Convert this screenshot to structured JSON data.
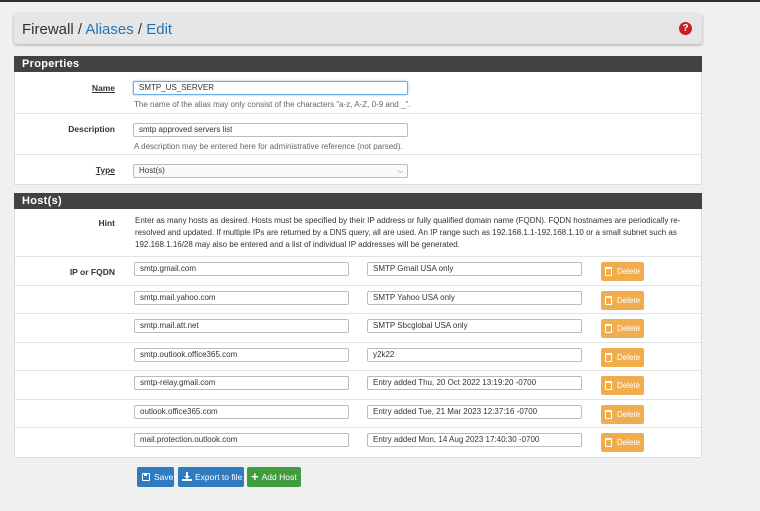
{
  "breadcrumb": {
    "root": "Firewall",
    "sep": "/",
    "aliases": "Aliases",
    "current": "Edit",
    "help": "?"
  },
  "properties": {
    "heading": "Properties",
    "name_label": "Name",
    "name_value": "SMTP_US_SERVER",
    "name_help": "The name of the alias may only consist of the characters \"a-z, A-Z, 0-9 and _\".",
    "description_label": "Description",
    "description_value": "smtp approved servers list",
    "description_help": "A description may be entered here for administrative reference (not parsed).",
    "type_label": "Type",
    "type_value": "Host(s)"
  },
  "hosts": {
    "heading": "Host(s)",
    "hint_label": "Hint",
    "hint_text": "Enter as many hosts as desired. Hosts must be specified by their IP address or fully qualified domain name (FQDN). FQDN hostnames are periodically re-resolved and updated. If multiple IPs are returned by a DNS query, all are used. An IP range such as 192.168.1.1-192.168.1.10 or a small subnet such as 192.168.1.16/28 may also be entered and a list of individual IP addresses will be generated.",
    "ip_label": "IP or FQDN",
    "delete_label": "Delete",
    "entries": [
      {
        "host": "smtp.gmail.com",
        "desc": "SMTP Gmail USA only"
      },
      {
        "host": "smtp.mail.yahoo.com",
        "desc": "SMTP Yahoo USA only"
      },
      {
        "host": "smtp.mail.att.net",
        "desc": "SMTP Sbcglobal USA only"
      },
      {
        "host": "smtp.outlook.office365.com",
        "desc": "y2k22"
      },
      {
        "host": "smtp-relay.gmail.com",
        "desc": "Entry added Thu, 20 Oct 2022 13:19:20 -0700"
      },
      {
        "host": "outlook.office365.com",
        "desc": "Entry added Tue, 21 Mar 2023 12:37:16 -0700"
      },
      {
        "host": "mail.protection.outlook.com",
        "desc": "Entry added Mon, 14 Aug 2023 17:40:30 -0700"
      }
    ]
  },
  "buttons": {
    "save": "Save",
    "export": "Export to file",
    "add_host": "Add Host"
  },
  "colors": {
    "heading_bg": "#424242",
    "link": "#2773b1",
    "delete": "#f0ad4e",
    "primary": "#2f7bc0",
    "success": "#3f9d3f"
  }
}
